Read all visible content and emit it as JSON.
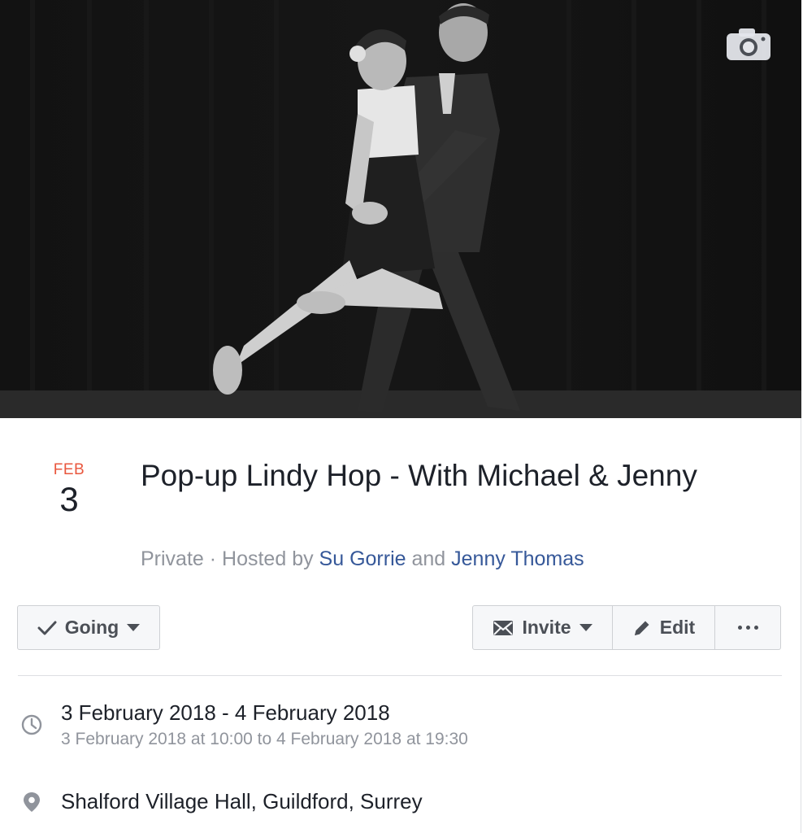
{
  "event": {
    "date": {
      "month": "FEB",
      "day": "3"
    },
    "title": "Pop-up Lindy Hop - With Michael & Jenny",
    "privacy": "Private",
    "separator": " · ",
    "hosted_by_label": "Hosted by ",
    "host1": "Su Gorrie",
    "and_label": " and ",
    "host2": "Jenny Thomas"
  },
  "actions": {
    "going_label": "Going",
    "invite_label": "Invite",
    "edit_label": "Edit"
  },
  "details": {
    "date_range": "3 February 2018 - 4 February 2018",
    "time_range": "3 February 2018 at 10:00 to 4 February 2018 at 19:30",
    "location": "Shalford Village Hall, Guildford, Surrey"
  },
  "icons": {
    "camera": "camera-icon",
    "check": "check-icon",
    "envelope": "envelope-icon",
    "pencil": "pencil-icon",
    "more": "more-dots-icon",
    "clock": "clock-icon",
    "pin": "map-pin-icon"
  },
  "colors": {
    "month": "#e9573e",
    "link": "#365899",
    "muted": "#90949c",
    "text": "#1d2129"
  }
}
